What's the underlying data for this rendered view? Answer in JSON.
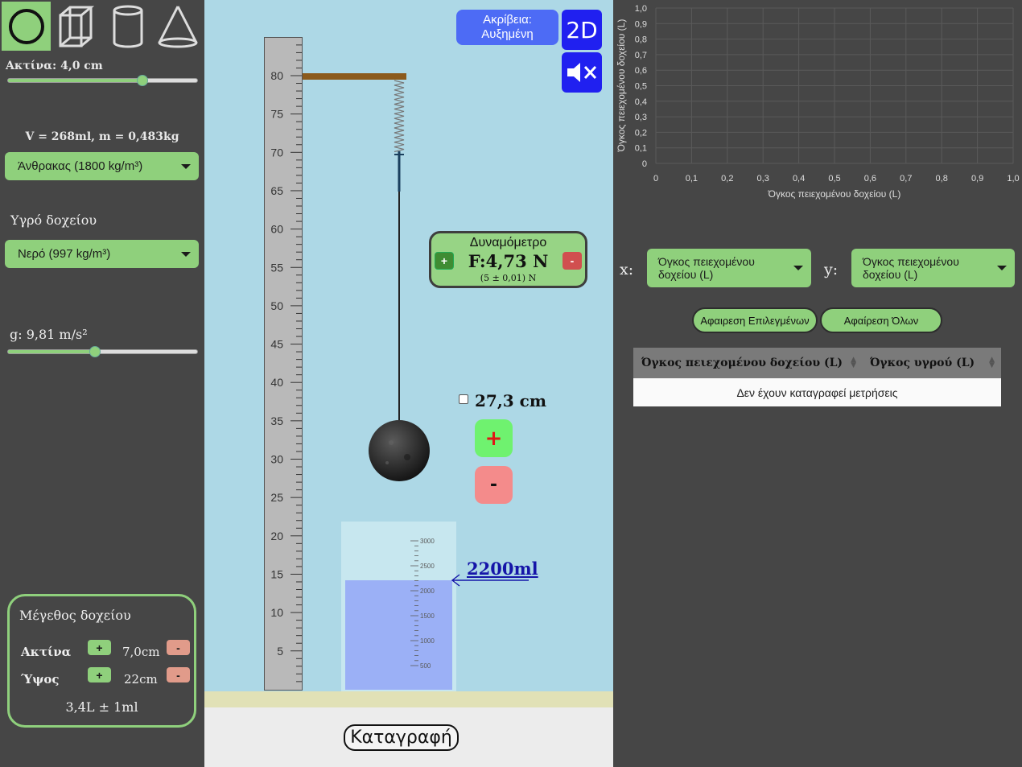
{
  "shapes": [
    {
      "name": "sphere",
      "selected": true
    },
    {
      "name": "cuboid",
      "selected": false
    },
    {
      "name": "cylinder",
      "selected": false
    },
    {
      "name": "cone",
      "selected": false
    }
  ],
  "left": {
    "radius_label": "Ακτίνα: 4,0 cm",
    "radius_value": 0.71,
    "volume_mass": "V = 268ml, m = 0,483kg",
    "material": "Άνθρακας (1800 kg/m³)",
    "liquid_title": "Υγρό δοχείου",
    "liquid": "Νερό (997 kg/m³)",
    "g_label": "g: 9,81 m/s²",
    "g_value": 0.46,
    "container": {
      "title": "Μέγεθος δοχείου",
      "radius_label": "Ακτίνα",
      "radius_value": "7,0cm",
      "height_label": "Ύψος",
      "height_value": "22cm",
      "plus": "+",
      "minus": "-",
      "capacity": "3,4L ± 1ml"
    }
  },
  "sim": {
    "accuracy_line1": "Ακρίβεια:",
    "accuracy_line2": "Αυξημένη",
    "mode_2d": "2D",
    "ruler_ticks": [
      "80",
      "75",
      "70",
      "65",
      "60",
      "55",
      "50",
      "45",
      "40",
      "35",
      "30",
      "25",
      "20",
      "15",
      "10",
      "5"
    ],
    "ruler_top_cut": "80",
    "dynamometer": {
      "title": "Δυναμόμετρο",
      "force": "F:4,73 N",
      "error": "(5 ± 0,01) N",
      "plus": "+",
      "minus": "-"
    },
    "height_value": "27,3 cm",
    "up": "+",
    "down": "-",
    "beaker_ticks": [
      "3000",
      "2500",
      "2000",
      "1500",
      "1000",
      "500"
    ],
    "liquid_level": "2200ml",
    "record": "Καταγραφή"
  },
  "right": {
    "chart_data": {
      "type": "scatter",
      "x": [],
      "y": [],
      "xlabel": "Όγκος πειεχομένου δοχείου (L)",
      "ylabel": "Όγκος πειεχομένου δοχείου (L)",
      "xlim": [
        0,
        1.0
      ],
      "ylim": [
        0,
        1.0
      ],
      "xticks": [
        "0",
        "0,1",
        "0,2",
        "0,3",
        "0,4",
        "0,5",
        "0,6",
        "0,7",
        "0,8",
        "0,9",
        "1,0"
      ],
      "yticks": [
        "0",
        "0,1",
        "0,2",
        "0,3",
        "0,4",
        "0,5",
        "0,6",
        "0,7",
        "0,8",
        "0,9",
        "1,0"
      ],
      "grid": true
    },
    "x_label": "x:",
    "y_label": "y:",
    "x_select": "Όγκος πειεχομένου δοχείου (L)",
    "y_select": "Όγκος πειεχομένου δοχείου (L)",
    "remove_selected": "Αφαιρεση Επιλεγμένων",
    "remove_all": "Αφαίρεση Όλων",
    "table": {
      "headers": [
        "Όγκος πειεχομένου δοχείου (L)",
        "Όγκος υγρού (L)"
      ],
      "empty": "Δεν έχουν καταγραφεί μετρήσεις"
    }
  },
  "colors": {
    "accent_green": "#8fd07c",
    "sim_bg": "#add8e6",
    "panel_bg": "#464646",
    "button_blue": "#2020f0"
  }
}
